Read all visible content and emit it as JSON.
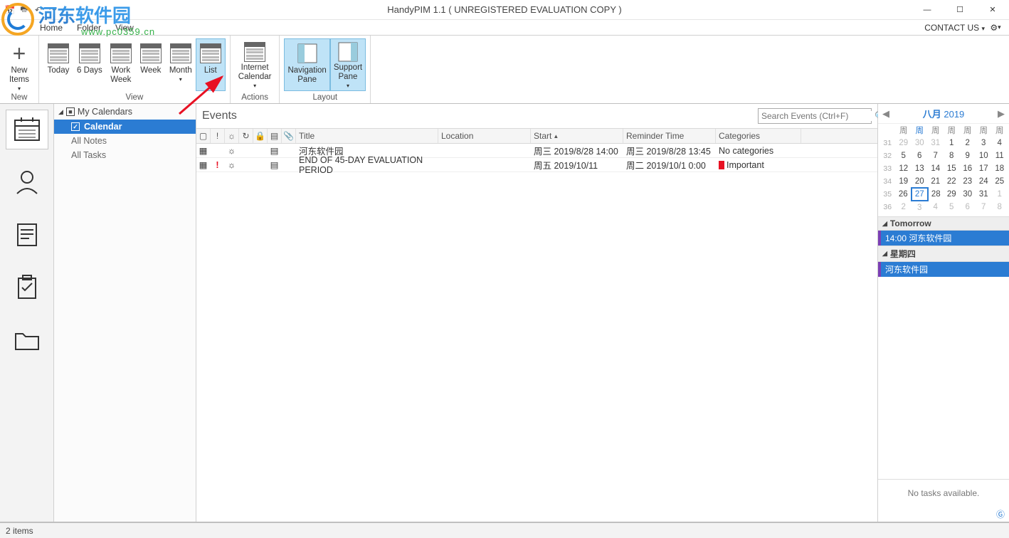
{
  "window": {
    "title": "HandyPIM 1.1 ( UNREGISTERED EVALUATION COPY )",
    "menus": {
      "home": "Home",
      "folder": "Folder",
      "view": "View"
    },
    "contact_us": "CONTACT US"
  },
  "watermark": {
    "text1": "河东",
    "text2": "软件园",
    "sub": "www.pc0359.cn"
  },
  "ribbon": {
    "groups": {
      "new": {
        "label": "New",
        "new_items": "New\nItems"
      },
      "view": {
        "label": "View",
        "today": "Today",
        "six_days": "6 Days",
        "work_week": "Work\nWeek",
        "week": "Week",
        "month": "Month",
        "list": "List"
      },
      "actions": {
        "label": "Actions",
        "internet_calendar": "Internet\nCalendar"
      },
      "layout": {
        "label": "Layout",
        "navigation_pane": "Navigation\nPane",
        "support_pane": "Support\nPane"
      }
    }
  },
  "nav": {
    "header": "My Calendars",
    "items": {
      "calendar": "Calendar",
      "all_notes": "All Notes",
      "all_tasks": "All Tasks"
    }
  },
  "main": {
    "title": "Events",
    "search_placeholder": "Search Events (Ctrl+F)",
    "columns": {
      "title": "Title",
      "location": "Location",
      "start": "Start",
      "reminder": "Reminder Time",
      "categories": "Categories"
    },
    "rows": [
      {
        "title": "河东软件园",
        "location": "",
        "start": "周三 2019/8/28 14:00",
        "reminder": "周三 2019/8/28 13:45",
        "categories": "No categories",
        "important": false
      },
      {
        "title": "END OF 45-DAY EVALUATION PERIOD",
        "location": "",
        "start": "周五 2019/10/11",
        "reminder": "周二 2019/10/1 0:00",
        "categories": "Important",
        "important": true
      }
    ]
  },
  "calendar": {
    "header_month": "八月",
    "header_year": "2019",
    "weekdays": [
      "周",
      "周",
      "周",
      "周",
      "周",
      "周",
      "周"
    ],
    "weeks": [
      {
        "wk": "31",
        "days": [
          "29",
          "30",
          "31",
          "1",
          "2",
          "3",
          "4"
        ],
        "other": [
          true,
          true,
          true,
          false,
          false,
          false,
          false
        ]
      },
      {
        "wk": "32",
        "days": [
          "5",
          "6",
          "7",
          "8",
          "9",
          "10",
          "11"
        ],
        "other": [
          false,
          false,
          false,
          false,
          false,
          false,
          false
        ]
      },
      {
        "wk": "33",
        "days": [
          "12",
          "13",
          "14",
          "15",
          "16",
          "17",
          "18"
        ],
        "other": [
          false,
          false,
          false,
          false,
          false,
          false,
          false
        ]
      },
      {
        "wk": "34",
        "days": [
          "19",
          "20",
          "21",
          "22",
          "23",
          "24",
          "25"
        ],
        "other": [
          false,
          false,
          false,
          false,
          false,
          false,
          false
        ]
      },
      {
        "wk": "35",
        "days": [
          "26",
          "27",
          "28",
          "29",
          "30",
          "31",
          "1"
        ],
        "other": [
          false,
          false,
          false,
          false,
          false,
          false,
          true
        ],
        "today_idx": 1
      },
      {
        "wk": "36",
        "days": [
          "2",
          "3",
          "4",
          "5",
          "6",
          "7",
          "8"
        ],
        "other": [
          true,
          true,
          true,
          true,
          true,
          true,
          true
        ]
      }
    ],
    "agenda": {
      "tomorrow_label": "Tomorrow",
      "tomorrow_item": "14:00 河东软件园",
      "thursday_label": "星期四",
      "thursday_item": "河东软件园"
    },
    "no_tasks": "No tasks available."
  },
  "status": {
    "items": "2 items"
  }
}
